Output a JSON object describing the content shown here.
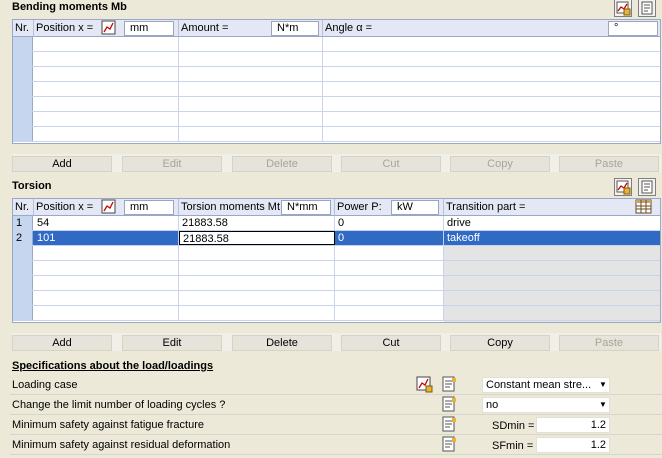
{
  "bending": {
    "title": "Bending moments Mb",
    "headers": {
      "nr": "Nr.",
      "position": "Position x =",
      "position_unit": "mm",
      "amount": "Amount =",
      "amount_unit": "N*m",
      "angle": "Angle α =",
      "angle_unit": "°"
    }
  },
  "bending_buttons": [
    "Add",
    "Edit",
    "Delete",
    "Cut",
    "Copy",
    "Paste"
  ],
  "torsion": {
    "title": "Torsion",
    "headers": {
      "nr": "Nr.",
      "position": "Position x =",
      "position_unit": "mm",
      "moment": "Torsion moments Mt:",
      "moment_unit": "N*mm",
      "power": "Power P:",
      "power_unit": "kW",
      "transition": "Transition  part ="
    },
    "rows": [
      {
        "nr": "1",
        "position": "54",
        "moment": "21883.58",
        "power": "0",
        "transition": "drive"
      },
      {
        "nr": "2",
        "position": "101",
        "moment": "21883.58",
        "power": "0",
        "transition": "takeoff"
      }
    ]
  },
  "torsion_buttons": [
    "Add",
    "Edit",
    "Delete",
    "Cut",
    "Copy",
    "Paste"
  ],
  "specs": {
    "title": "Specifications about the load/loadings",
    "loading_case": {
      "label": "Loading case",
      "value": "Constant mean stre..."
    },
    "limit_cycles": {
      "label": "Change the limit number of loading cycles ?",
      "value": "no"
    },
    "fatigue": {
      "label": "Minimum safety against fatigue fracture",
      "symbol": "SDmin =",
      "value": "1.2"
    },
    "residual": {
      "label": "Minimum safety against residual deformation",
      "symbol": "SFmin =",
      "value": "1.2"
    }
  },
  "colors": {
    "selection": "#316ac5",
    "header": "#e3e8f4",
    "rownum": "#c7d6ef"
  }
}
